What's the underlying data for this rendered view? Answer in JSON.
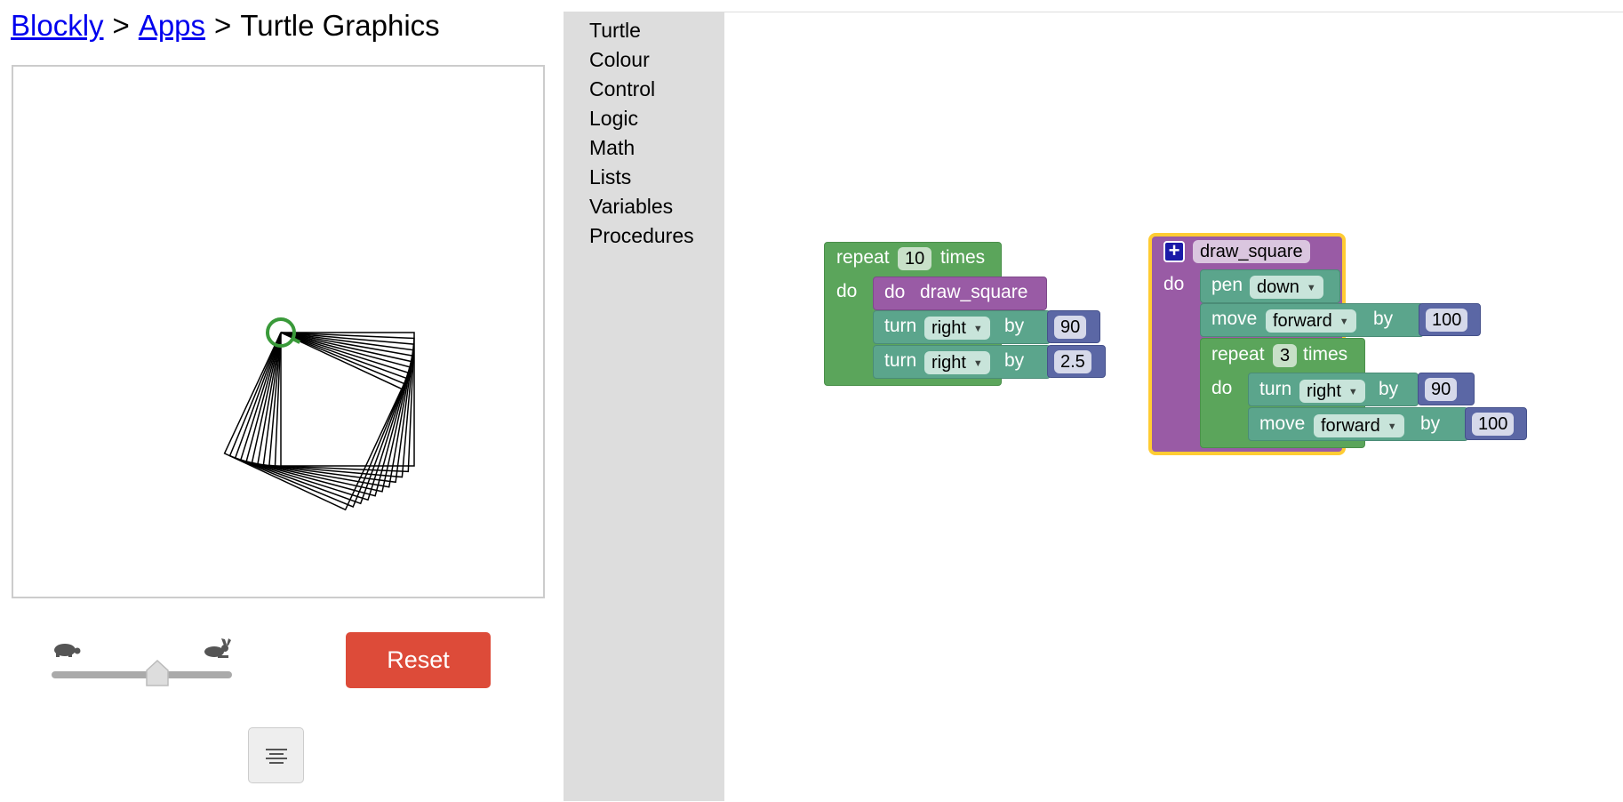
{
  "breadcrumb": {
    "root": "Blockly",
    "apps": "Apps",
    "sep": ">",
    "title": "Turtle Graphics"
  },
  "speed": {
    "slow_icon": "turtle-icon",
    "fast_icon": "rabbit-icon",
    "value": 0.6
  },
  "buttons": {
    "reset": "Reset",
    "show_code_icon": "code-lines-icon"
  },
  "toolbox": {
    "categories": [
      "Turtle",
      "Colour",
      "Control",
      "Logic",
      "Math",
      "Lists",
      "Variables",
      "Procedures"
    ]
  },
  "blocks": {
    "repeat_main": {
      "repeat": "repeat",
      "count": "10",
      "times": "times",
      "do": "do"
    },
    "call": {
      "do": "do",
      "name": "draw_square"
    },
    "turn1": {
      "turn": "turn",
      "dir": "right",
      "by": "by",
      "value": "90"
    },
    "turn2": {
      "turn": "turn",
      "dir": "right",
      "by": "by",
      "value": "2.5"
    },
    "def": {
      "name": "draw_square",
      "do": "do"
    },
    "pen": {
      "pen": "pen",
      "state": "down"
    },
    "move1": {
      "move": "move",
      "dir": "forward",
      "by": "by",
      "value": "100"
    },
    "repeat_inner": {
      "repeat": "repeat",
      "count": "3",
      "times": "times",
      "do": "do"
    },
    "turn3": {
      "turn": "turn",
      "dir": "right",
      "by": "by",
      "value": "90"
    },
    "move2": {
      "move": "move",
      "dir": "forward",
      "by": "by",
      "value": "100"
    }
  },
  "colors": {
    "reset": "#dd4b39",
    "loop": "#5ba55b",
    "procedure": "#995ba5",
    "turtle": "#5ba58c",
    "math": "#5b67a5",
    "selected": "#fc3"
  },
  "drawing": {
    "shape": "square",
    "squares": 11,
    "side": 100,
    "turn_step_deg": 2.5
  }
}
